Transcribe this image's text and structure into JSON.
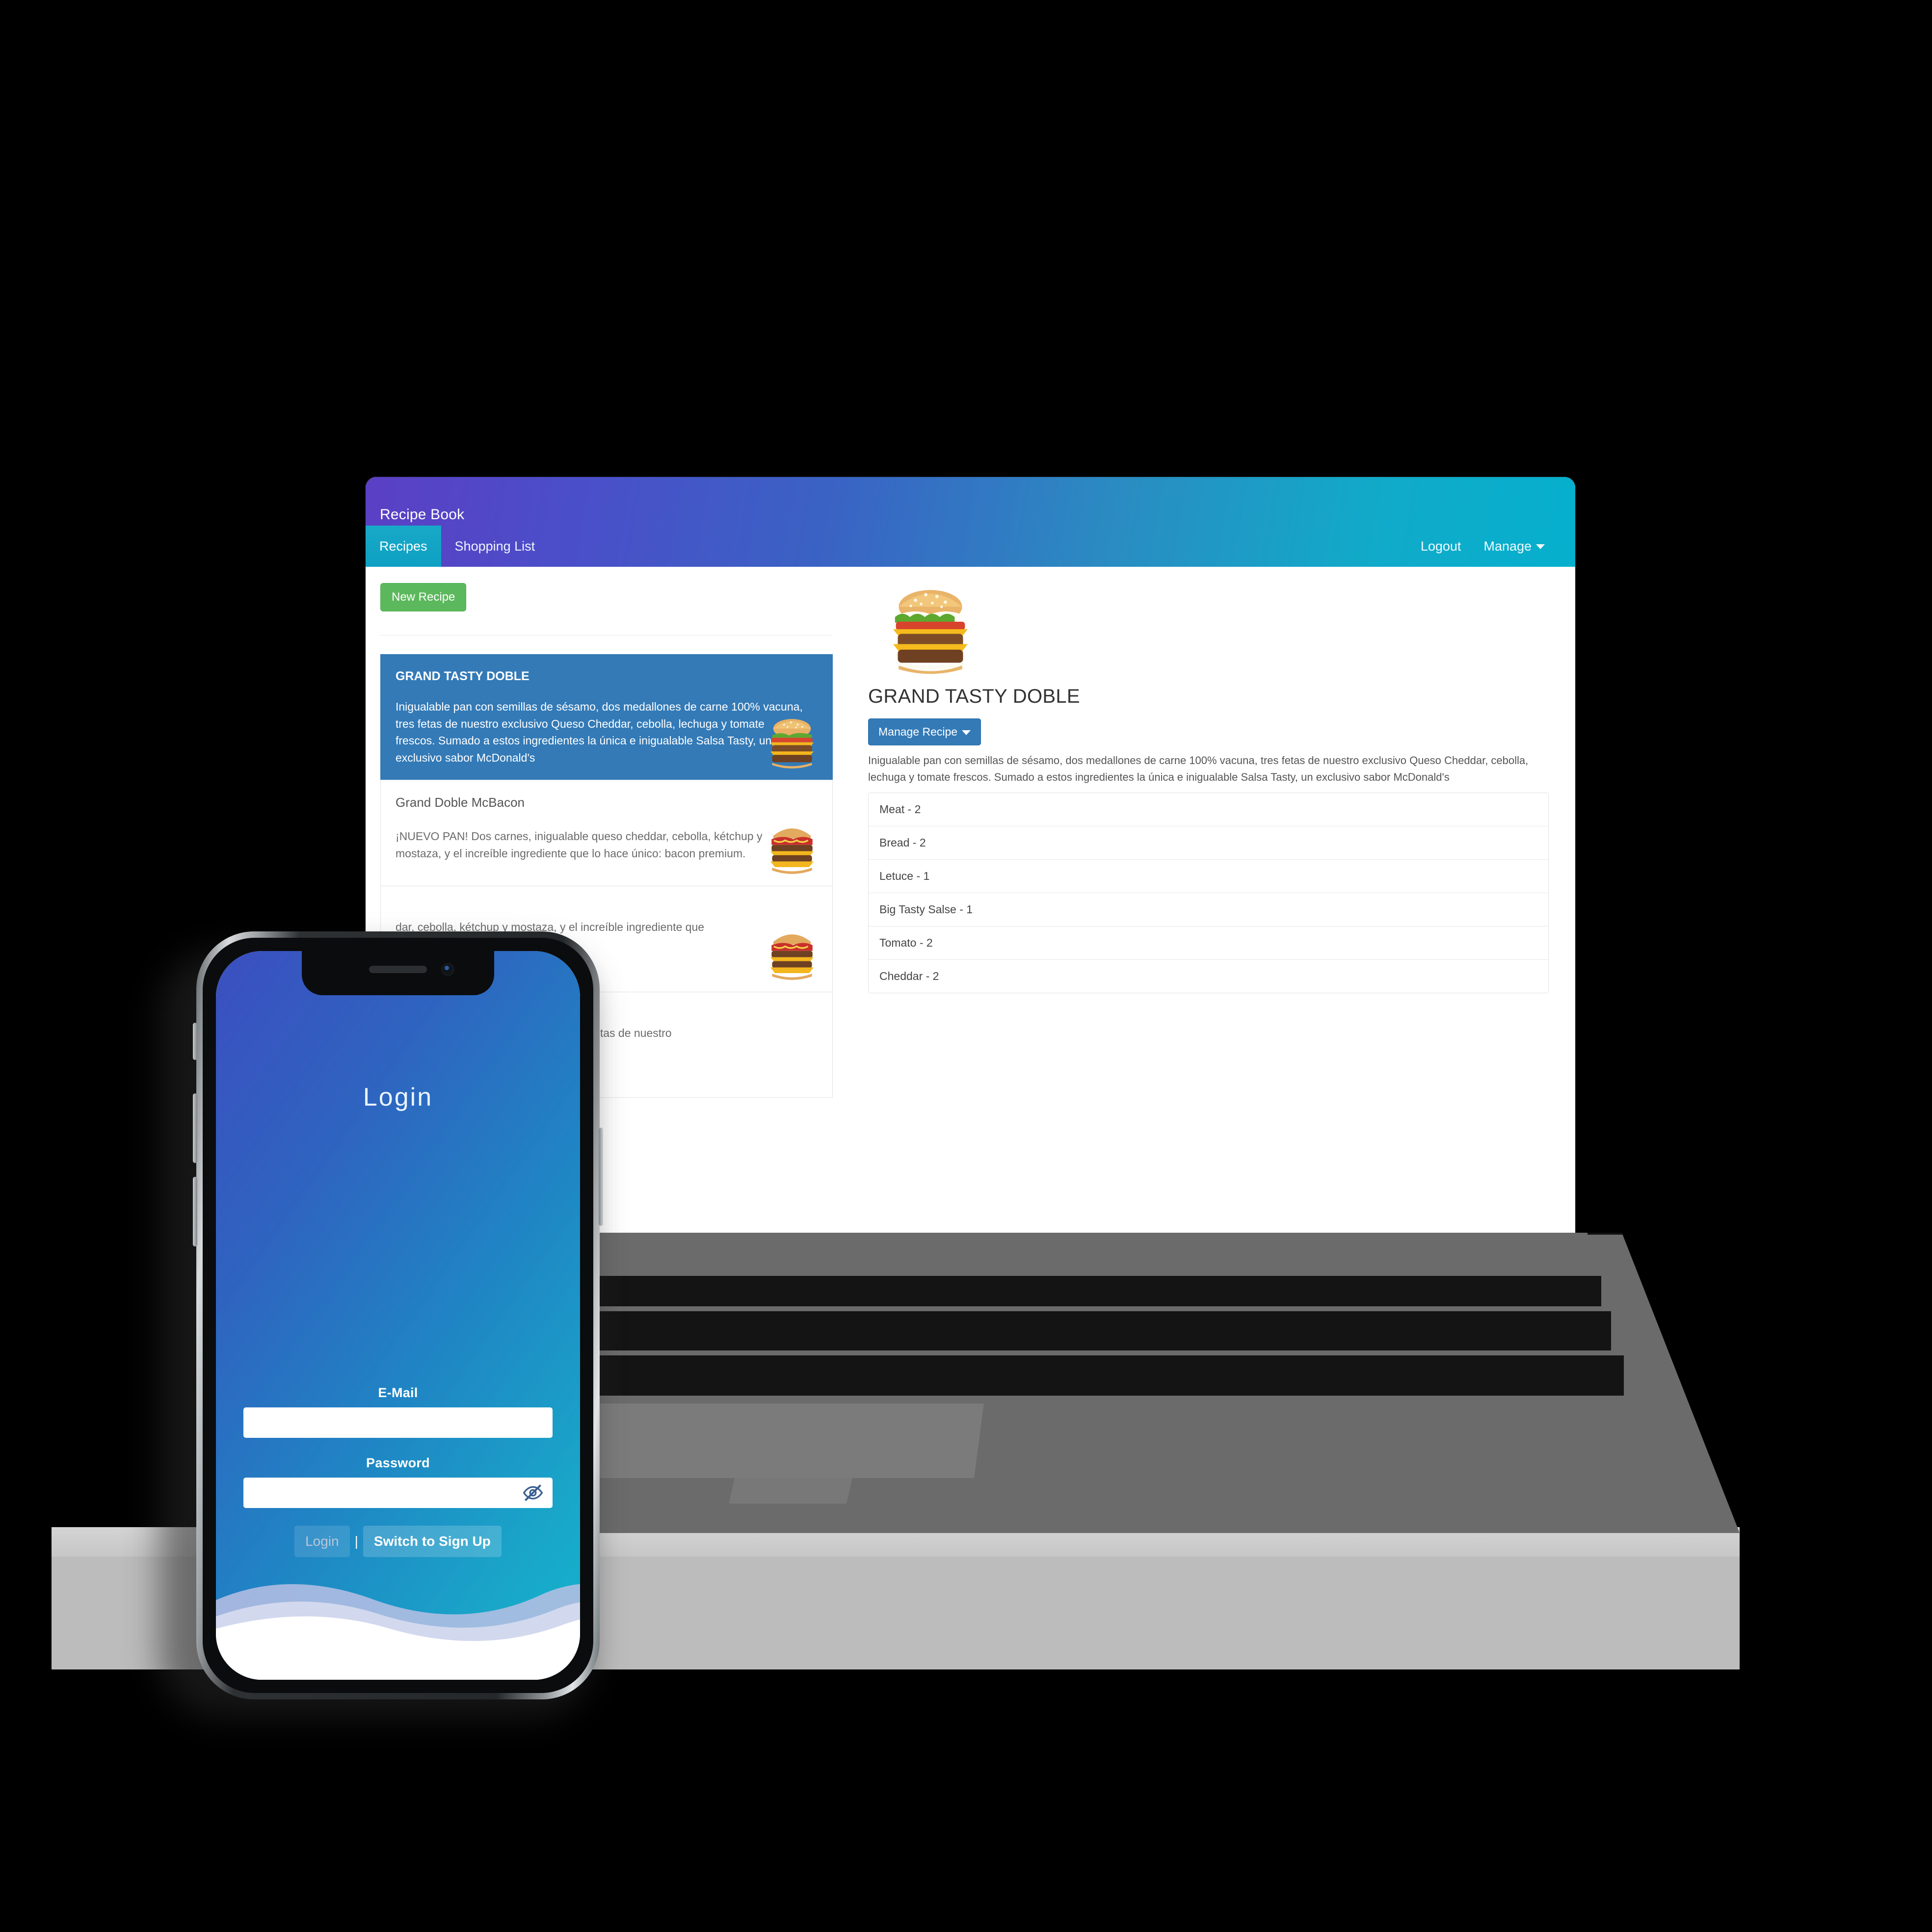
{
  "desktop": {
    "navbar": {
      "brand": "Recipe Book",
      "tabs": [
        {
          "label": "Recipes",
          "active": true
        },
        {
          "label": "Shopping List",
          "active": false
        }
      ],
      "right_links": [
        {
          "label": "Logout",
          "caret": false
        },
        {
          "label": "Manage",
          "caret": true
        }
      ]
    },
    "toolbar": {
      "new_recipe_label": "New Recipe"
    },
    "recipe_list": [
      {
        "name": "GRAND TASTY DOBLE",
        "description": "Inigualable pan con semillas de sésamo, dos medallones de carne 100% vacuna, tres fetas de nuestro exclusivo Queso Cheddar, cebolla, lechuga y tomate frescos. Sumado a estos ingredientes la única e inigualable Salsa Tasty, un exclusivo sabor McDonald's",
        "thumbnail": "burger-double-cheese-image",
        "selected": true
      },
      {
        "name": "Grand Doble McBacon",
        "description": "¡NUEVO PAN! Dos carnes, inigualable queso cheddar, cebolla, kétchup y mostaza, y el increíble ingrediente que lo hace único: bacon premium.",
        "thumbnail": "burger-bacon-image",
        "selected": false
      },
      {
        "name": "",
        "description": "dar, cebolla, kétchup y mostaza, y el increíble ingrediente que",
        "thumbnail": "burger-bacon-image",
        "selected": false
      },
      {
        "name": "",
        "description": "allones de carne 100% vacuna, cuatro fetas de nuestro",
        "thumbnail": "",
        "selected": false
      }
    ],
    "detail": {
      "image": "burger-double-cheese-image",
      "title": "GRAND TASTY DOBLE",
      "manage_button_label": "Manage Recipe",
      "description": "Inigualable pan con semillas de sésamo, dos medallones de carne 100% vacuna, tres fetas de nuestro exclusivo Queso Cheddar, cebolla, lechuga y tomate frescos. Sumado a estos ingredientes la única e inigualable Salsa Tasty, un exclusivo sabor McDonald's",
      "ingredients": [
        "Meat - 2",
        "Bread - 2",
        "Letuce - 1",
        "Big Tasty Salse - 1",
        "Tomato - 2",
        "Cheddar - 2"
      ]
    }
  },
  "phone": {
    "screen_title": "Login",
    "fields": [
      {
        "label": "E-Mail",
        "value": "",
        "type": "email"
      },
      {
        "label": "Password",
        "value": "",
        "type": "password",
        "toggle_icon": "eye-off-icon"
      }
    ],
    "actions": {
      "login_label": "Login",
      "separator": "|",
      "switch_label": "Switch to Sign Up"
    }
  },
  "colors": {
    "nav_start": "#5b3fc4",
    "nav_end": "#05b0cd",
    "primary": "#337ab7",
    "success": "#5cb85c",
    "phone_gradient_start": "#3b4fc0",
    "phone_gradient_end": "#12b4cd"
  }
}
